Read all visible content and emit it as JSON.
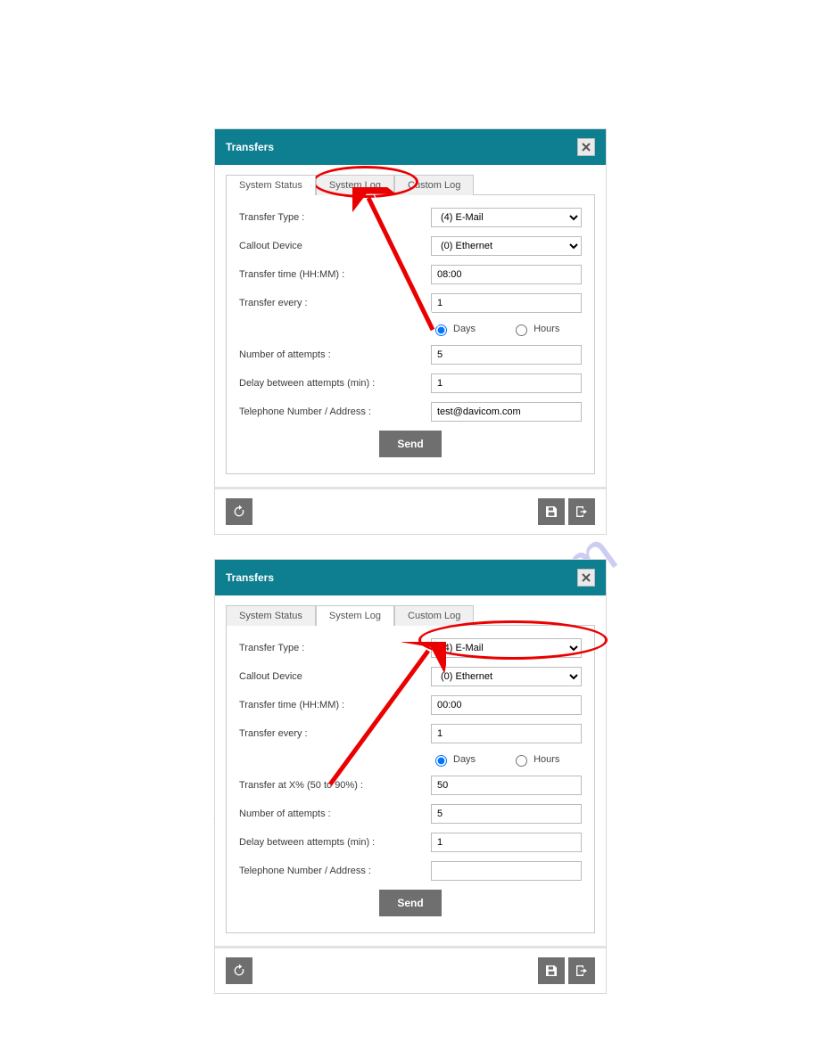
{
  "panel1": {
    "title": "Transfers",
    "tabs": [
      "System Status",
      "System Log",
      "Custom Log"
    ],
    "active_tab": 0,
    "form": {
      "transfer_type_label": "Transfer Type :",
      "transfer_type_value": "(4) E-Mail",
      "callout_device_label": "Callout Device",
      "callout_device_value": "(0) Ethernet",
      "transfer_time_label": "Transfer time (HH:MM) :",
      "transfer_time_value": "08:00",
      "transfer_every_label": "Transfer every :",
      "transfer_every_value": "1",
      "days_label": "Days",
      "hours_label": "Hours",
      "attempts_label": "Number of attempts :",
      "attempts_value": "5",
      "delay_label": "Delay between attempts (min) :",
      "delay_value": "1",
      "phone_label": "Telephone Number / Address :",
      "phone_value": "test@davicom.com",
      "send_label": "Send"
    }
  },
  "panel2": {
    "title": "Transfers",
    "tabs": [
      "System Status",
      "System Log",
      "Custom Log"
    ],
    "active_tab": 1,
    "form": {
      "transfer_type_label": "Transfer Type :",
      "transfer_type_value": "(4) E-Mail",
      "callout_device_label": "Callout Device",
      "callout_device_value": "(0) Ethernet",
      "transfer_time_label": "Transfer time (HH:MM) :",
      "transfer_time_value": "00:00",
      "transfer_every_label": "Transfer every :",
      "transfer_every_value": "1",
      "days_label": "Days",
      "hours_label": "Hours",
      "transfer_pct_label": "Transfer at X% (50 to 90%) :",
      "transfer_pct_value": "50",
      "attempts_label": "Number of attempts :",
      "attempts_value": "5",
      "delay_label": "Delay between attempts (min) :",
      "delay_value": "1",
      "phone_label": "Telephone Number / Address :",
      "phone_value": "",
      "send_label": "Send"
    }
  },
  "watermark": "manualshive.com"
}
